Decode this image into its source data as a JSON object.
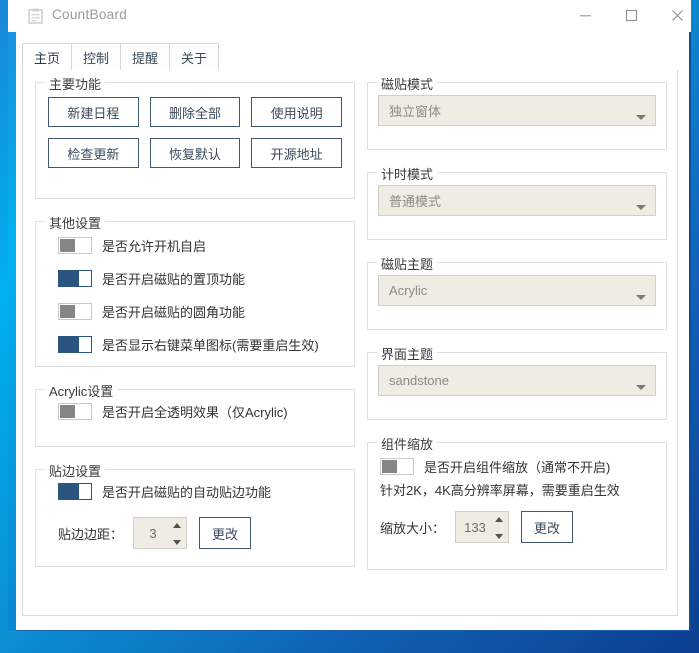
{
  "window": {
    "title": "CountBoard",
    "icon": "clipboard-icon",
    "minimize_label": "─",
    "maximize_label": "□",
    "close_label": "✕",
    "accent_color": "#00b2f0",
    "button_border_color": "#3f5771",
    "switch_on_color": "#2b5580",
    "combo_background_color": "#efece4"
  },
  "tabs": [
    {
      "label": "主页",
      "active": true
    },
    {
      "label": "控制",
      "active": false
    },
    {
      "label": "提醒",
      "active": false
    },
    {
      "label": "关于",
      "active": false
    }
  ],
  "groups": {
    "main_functions": {
      "legend": "主要功能",
      "buttons_row1": [
        "新建日程",
        "删除全部",
        "使用说明"
      ],
      "buttons_row2": [
        "检查更新",
        "恢复默认",
        "开源地址"
      ]
    },
    "other_settings": {
      "legend": "其他设置",
      "switches": [
        {
          "label": "是否允许开机自启",
          "on": false
        },
        {
          "label": "是否开启磁贴的置顶功能",
          "on": true
        },
        {
          "label": "是否开启磁贴的圆角功能",
          "on": false
        },
        {
          "label": "是否显示右键菜单图标(需要重启生效)",
          "on": true
        }
      ]
    },
    "acrylic_settings": {
      "legend": "Acrylic设置",
      "switches": [
        {
          "label": "是否开启全透明效果（仅Acrylic)",
          "on": false
        }
      ]
    },
    "edge_settings": {
      "legend": "贴边设置",
      "switches": [
        {
          "label": "是否开启磁贴的自动贴边功能",
          "on": true
        }
      ],
      "spin_caption": "贴边边距：",
      "spin_value": "3",
      "apply_label": "更改"
    },
    "tile_mode": {
      "legend": "磁贴模式",
      "selected": "独立窗体",
      "options": [
        "独立窗体"
      ]
    },
    "timing_mode": {
      "legend": "计时模式",
      "selected": "普通模式",
      "options": [
        "普通模式"
      ]
    },
    "tile_theme": {
      "legend": "磁贴主题",
      "selected": "Acrylic",
      "options": [
        "Acrylic"
      ]
    },
    "ui_theme": {
      "legend": "界面主题",
      "selected": "sandstone",
      "options": [
        "sandstone"
      ]
    },
    "widget_scaling": {
      "legend": "组件缩放",
      "switches": [
        {
          "label": "是否开启组件缩放（通常不开启)",
          "on": false
        }
      ],
      "note": "针对2K，4K高分辨率屏幕，需要重启生效",
      "spin_caption": "缩放大小：",
      "spin_value": "133",
      "apply_label": "更改"
    }
  }
}
